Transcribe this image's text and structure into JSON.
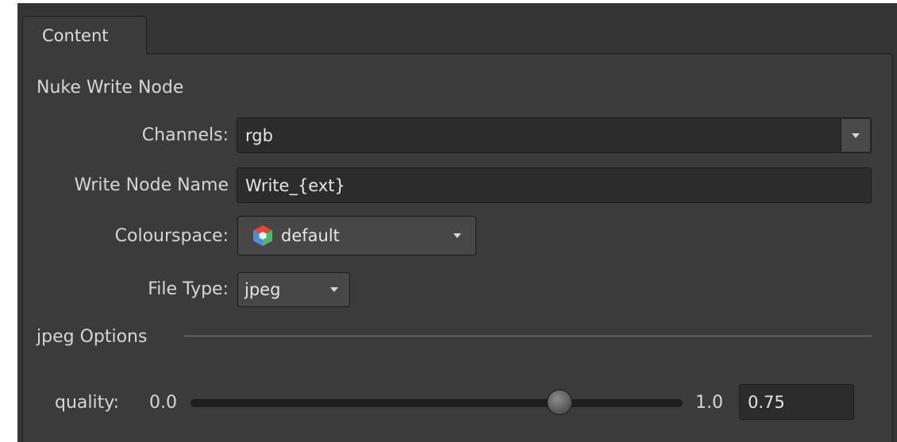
{
  "tabs": [
    {
      "label": "Content"
    }
  ],
  "section_title": "Nuke Write Node",
  "channels": {
    "label": "Channels:",
    "value": "rgb"
  },
  "write_node_name": {
    "label": "Write Node Name",
    "value": "Write_{ext}"
  },
  "colourspace": {
    "label": "Colourspace:",
    "value": "default",
    "icon": "color-management-icon"
  },
  "file_type": {
    "label": "File Type:",
    "value": "jpeg"
  },
  "options_group": {
    "label": "jpeg Options"
  },
  "quality": {
    "label": "quality:",
    "min_label": "0.0",
    "max_label": "1.0",
    "min": 0.0,
    "max": 1.0,
    "value": 0.75,
    "value_text": "0.75"
  },
  "colors": {
    "panel_bg": "#3b3b3b",
    "field_bg": "#2c2c2c",
    "text": "#d6d6d6"
  }
}
